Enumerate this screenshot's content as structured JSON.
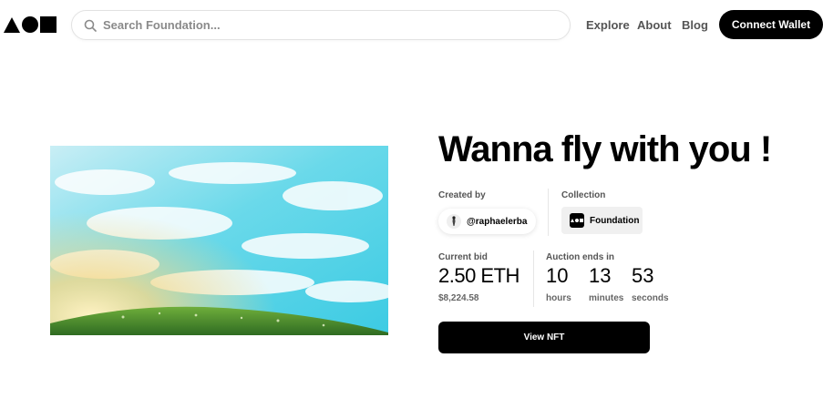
{
  "header": {
    "search_placeholder": "Search Foundation...",
    "nav": {
      "explore": "Explore",
      "about": "About",
      "blog": "Blog"
    },
    "connect_wallet": "Connect Wallet"
  },
  "artwork": {
    "title": "Wanna fly with you !",
    "created_by_label": "Created by",
    "creator": "@raphaelerba",
    "collection_label": "Collection",
    "collection": "Foundation",
    "current_bid_label": "Current bid",
    "current_bid": "2.50 ETH",
    "current_bid_usd": "$8,224.58",
    "auction_label": "Auction ends in",
    "countdown": {
      "hours": "10",
      "hours_label": "hours",
      "minutes": "13",
      "minutes_label": "minutes",
      "seconds": "53",
      "seconds_label": "seconds"
    },
    "view_button": "View NFT"
  },
  "colors": {
    "accent": "#000000",
    "sky_top": "#4fd1e6",
    "sky_light": "#e9f7fb",
    "grass": "#3f8a2e",
    "sun": "#f7c96a"
  }
}
